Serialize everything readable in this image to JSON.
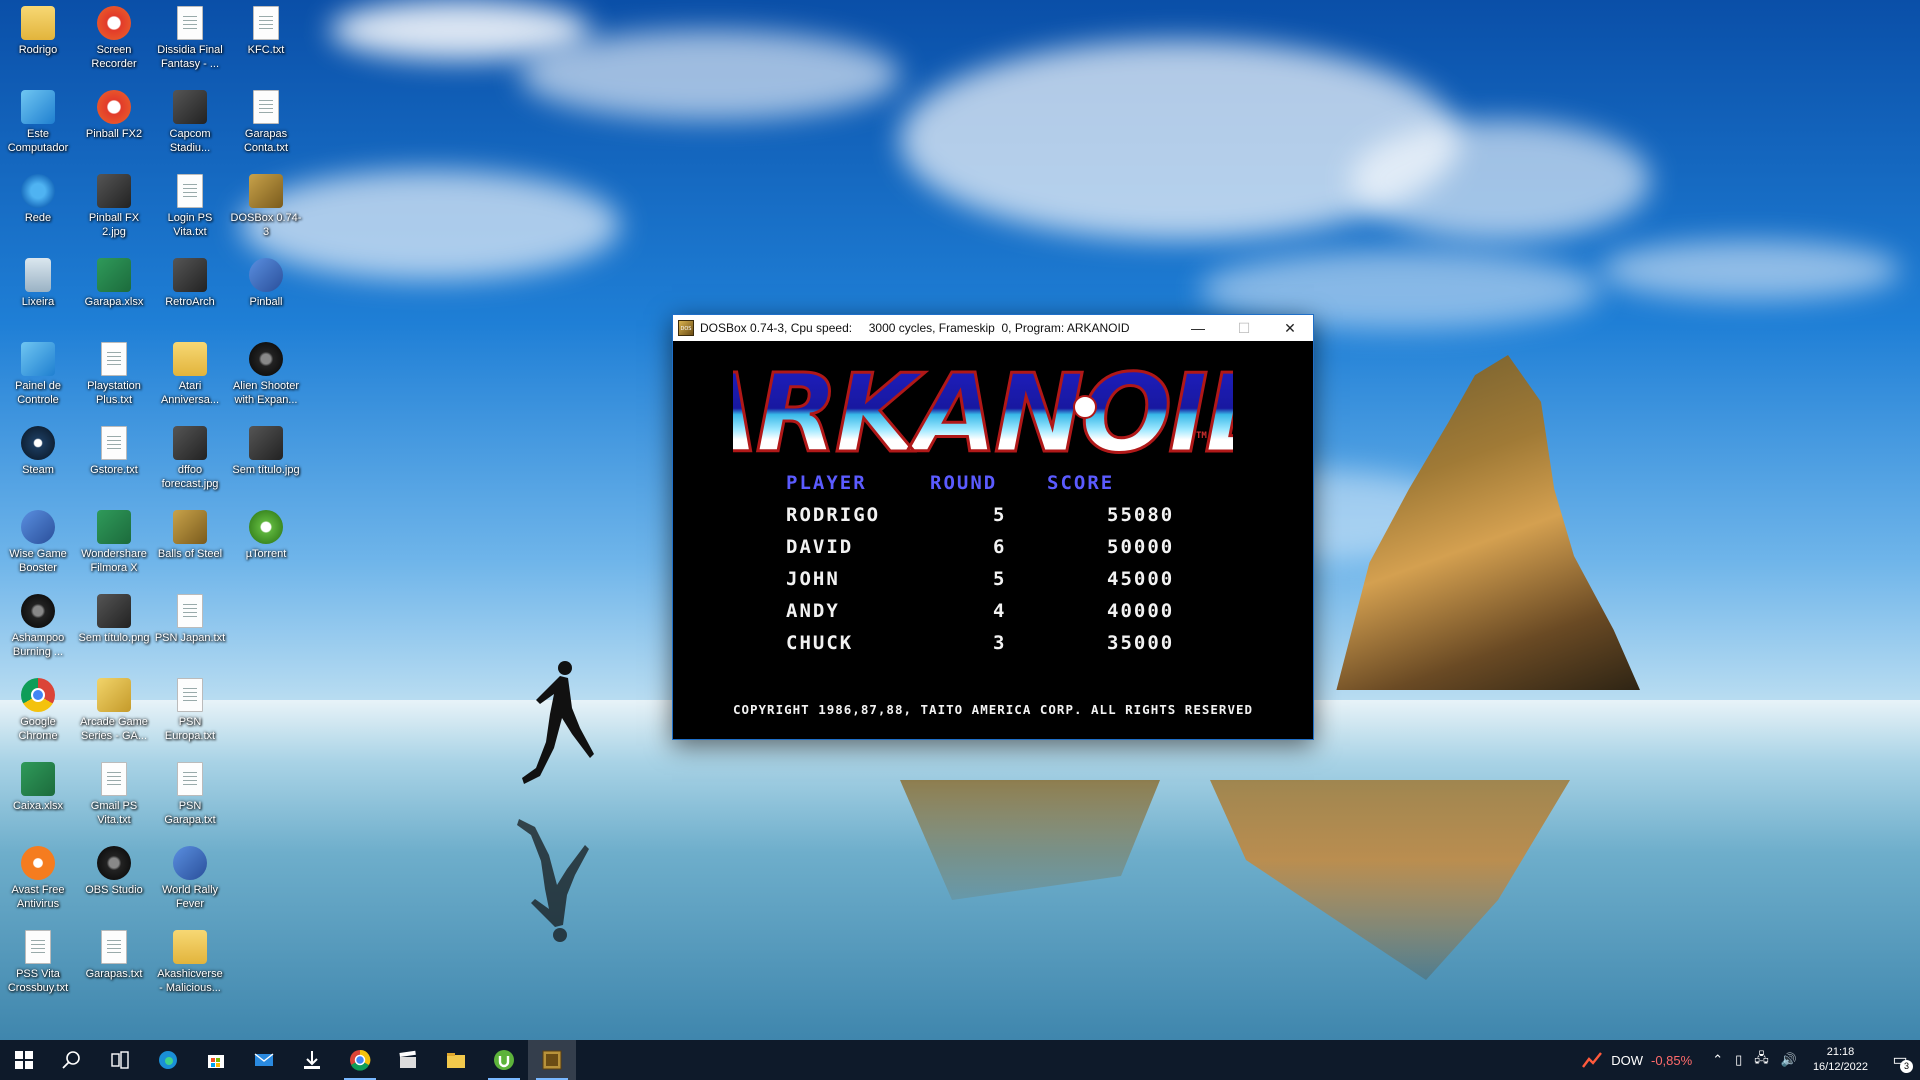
{
  "desktop": {
    "icons": [
      {
        "label": "Rodrigo",
        "icon": "user-folder-icon"
      },
      {
        "label": "Screen Recorder",
        "icon": "screen-recorder-icon"
      },
      {
        "label": "Dissidia Final Fantasy - ...",
        "icon": "text-file-icon"
      },
      {
        "label": "KFC.txt",
        "icon": "text-file-icon"
      },
      {
        "label": "Este Computador",
        "icon": "computer-icon"
      },
      {
        "label": "Pinball FX2",
        "icon": "pinball-icon"
      },
      {
        "label": "Capcom Stadiu...",
        "icon": "image-file-icon"
      },
      {
        "label": "Garapas Conta.txt",
        "icon": "text-file-icon"
      },
      {
        "label": "Rede",
        "icon": "network-icon"
      },
      {
        "label": "Pinball FX 2.jpg",
        "icon": "image-file-icon"
      },
      {
        "label": "Login PS Vita.txt",
        "icon": "text-file-icon"
      },
      {
        "label": "DOSBox 0.74-3",
        "icon": "dosbox-icon"
      },
      {
        "label": "Lixeira",
        "icon": "recycle-bin-icon"
      },
      {
        "label": "Garapa.xlsx",
        "icon": "excel-file-icon"
      },
      {
        "label": "RetroArch",
        "icon": "retroarch-icon"
      },
      {
        "label": "Pinball",
        "icon": "pinball-icon"
      },
      {
        "label": "Painel de Controle",
        "icon": "control-panel-icon"
      },
      {
        "label": "Playstation Plus.txt",
        "icon": "text-file-icon"
      },
      {
        "label": "Atari Anniversa...",
        "icon": "folder-icon"
      },
      {
        "label": "Alien Shooter with Expan...",
        "icon": "alien-shooter-icon"
      },
      {
        "label": "Steam",
        "icon": "steam-icon"
      },
      {
        "label": "Gstore.txt",
        "icon": "text-file-icon"
      },
      {
        "label": "dffoo forecast.jpg",
        "icon": "image-file-icon"
      },
      {
        "label": "Sem título.jpg",
        "icon": "image-file-icon"
      },
      {
        "label": "Wise Game Booster",
        "icon": "game-booster-icon"
      },
      {
        "label": "Wondershare Filmora X",
        "icon": "filmora-icon"
      },
      {
        "label": "Balls of Steel",
        "icon": "dosbox-icon"
      },
      {
        "label": "µTorrent",
        "icon": "utorrent-icon"
      },
      {
        "label": "Ashampoo Burning ...",
        "icon": "ashampoo-icon"
      },
      {
        "label": "Sem título.png",
        "icon": "image-file-icon"
      },
      {
        "label": "PSN Japan.txt",
        "icon": "text-file-icon"
      },
      {
        "label": "Google Chrome",
        "icon": "chrome-icon"
      },
      {
        "label": "Arcade Game Series - GA...",
        "icon": "arcade-icon"
      },
      {
        "label": "PSN Europa.txt",
        "icon": "text-file-icon"
      },
      {
        "label": "Caixa.xlsx",
        "icon": "excel-file-icon"
      },
      {
        "label": "Gmail PS Vita.txt",
        "icon": "text-file-icon"
      },
      {
        "label": "PSN Garapa.txt",
        "icon": "text-file-icon"
      },
      {
        "label": "Avast Free Antivirus",
        "icon": "avast-icon"
      },
      {
        "label": "OBS Studio",
        "icon": "obs-icon"
      },
      {
        "label": "World Rally Fever",
        "icon": "world-rally-icon"
      },
      {
        "label": "PSS Vita Crossbuy.txt",
        "icon": "text-file-icon"
      },
      {
        "label": "Garapas.txt",
        "icon": "text-file-icon"
      },
      {
        "label": "Akashicverse - Malicious...",
        "icon": "folder-icon"
      }
    ]
  },
  "window": {
    "title": "DOSBox 0.74-3, Cpu speed:     3000 cycles, Frameskip  0, Program: ARKANOID",
    "minimize": "—",
    "maximize": "☐",
    "close": "✕"
  },
  "game": {
    "logo_text": "ARKANOID",
    "trademark": "TM",
    "headers": {
      "player": "PLAYER",
      "round": "ROUND",
      "score": "SCORE"
    },
    "rows": [
      {
        "player": "RODRIGO",
        "round": "5",
        "score": "55080"
      },
      {
        "player": "DAVID",
        "round": "6",
        "score": "50000"
      },
      {
        "player": "JOHN",
        "round": "5",
        "score": "45000"
      },
      {
        "player": "ANDY",
        "round": "4",
        "score": "40000"
      },
      {
        "player": "CHUCK",
        "round": "3",
        "score": "35000"
      }
    ],
    "copyright": "COPYRIGHT 1986,87,88, TAITO AMERICA CORP. ALL RIGHTS RESERVED"
  },
  "taskbar": {
    "apps": [
      "start-icon",
      "search-icon",
      "task-view-icon",
      "edge-icon",
      "store-icon",
      "mail-icon",
      "download-icon",
      "chrome-icon",
      "clapper-icon",
      "file-explorer-icon",
      "utorrent-icon",
      "dosbox-icon"
    ],
    "ticker_symbol": "DOW",
    "ticker_change": "-0,85%",
    "time": "21:18",
    "date": "16/12/2022",
    "notification_count": "3"
  },
  "colors": {
    "header_blue": "#5b5bff",
    "ticker_red": "#ff6b6b"
  }
}
